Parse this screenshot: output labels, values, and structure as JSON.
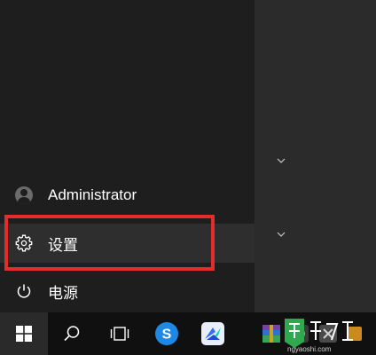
{
  "user": {
    "name": "Administrator",
    "icon": "user-avatar-icon"
  },
  "menu": {
    "settings_label": "设置",
    "settings_icon": "gear-icon",
    "power_label": "电源",
    "power_icon": "power-icon"
  },
  "taskbar": {
    "start_icon": "windows-logo-icon",
    "search_icon": "search-icon",
    "task_view_icon": "task-view-icon",
    "apps": [
      "sogou-browser-icon",
      "feishu-icon",
      "winrar-icon",
      "app-icon"
    ]
  },
  "colors": {
    "highlight": "#e52b2b",
    "menu_bg": "#1e1e1e",
    "tiles_bg": "#2b2b2b",
    "taskbar_bg": "#101010",
    "watermark_green": "#2fa84f"
  },
  "watermark": {
    "text": "ngyaoshi.com"
  }
}
